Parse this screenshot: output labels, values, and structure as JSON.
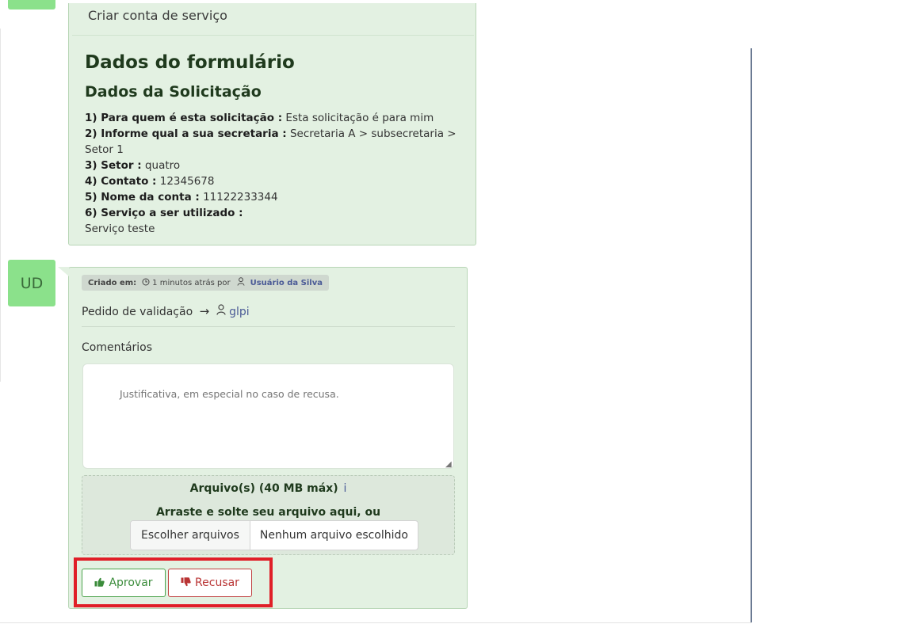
{
  "ticket": {
    "subject": "Criar conta de serviço",
    "form_title": "Dados do formulário",
    "form_section": "Dados da Solicitação",
    "answers": [
      {
        "q": "1) Para quem é esta solicitação :",
        "a": "Esta solicitação é para mim"
      },
      {
        "q": "2) Informe qual a sua secretaria :",
        "a": "Secretaria A > subsecretaria > Setor 1"
      },
      {
        "q": "3) Setor :",
        "a": "quatro"
      },
      {
        "q": "4) Contato :",
        "a": "12345678"
      },
      {
        "q": "5) Nome da conta :",
        "a": "11122233344"
      },
      {
        "q": "6) Serviço a ser utilizado :",
        "a": "Serviço teste"
      }
    ]
  },
  "validation": {
    "avatar_initials": "UD",
    "created_label": "Criado em:",
    "created_when": "1 minutos atrás por",
    "created_by": "Usuário da Silva",
    "request_label": "Pedido de validação",
    "target_user": "glpi",
    "comments_label": "Comentários",
    "comments_placeholder": "Justificativa, em especial no caso de recusa.",
    "files_label": "Arquivo(s) (40 MB máx)",
    "drag_text": "Arraste e solte seu arquivo aqui, ou",
    "choose_files": "Escolher arquivos",
    "no_file": "Nenhum arquivo escolhido",
    "approve": "Aprovar",
    "refuse": "Recusar"
  },
  "colors": {
    "card_bg": "#e3f1e2",
    "avatar_bg": "#8be18b",
    "approve": "#3b8c3b",
    "refuse": "#b93434",
    "highlight": "#e01f28"
  }
}
